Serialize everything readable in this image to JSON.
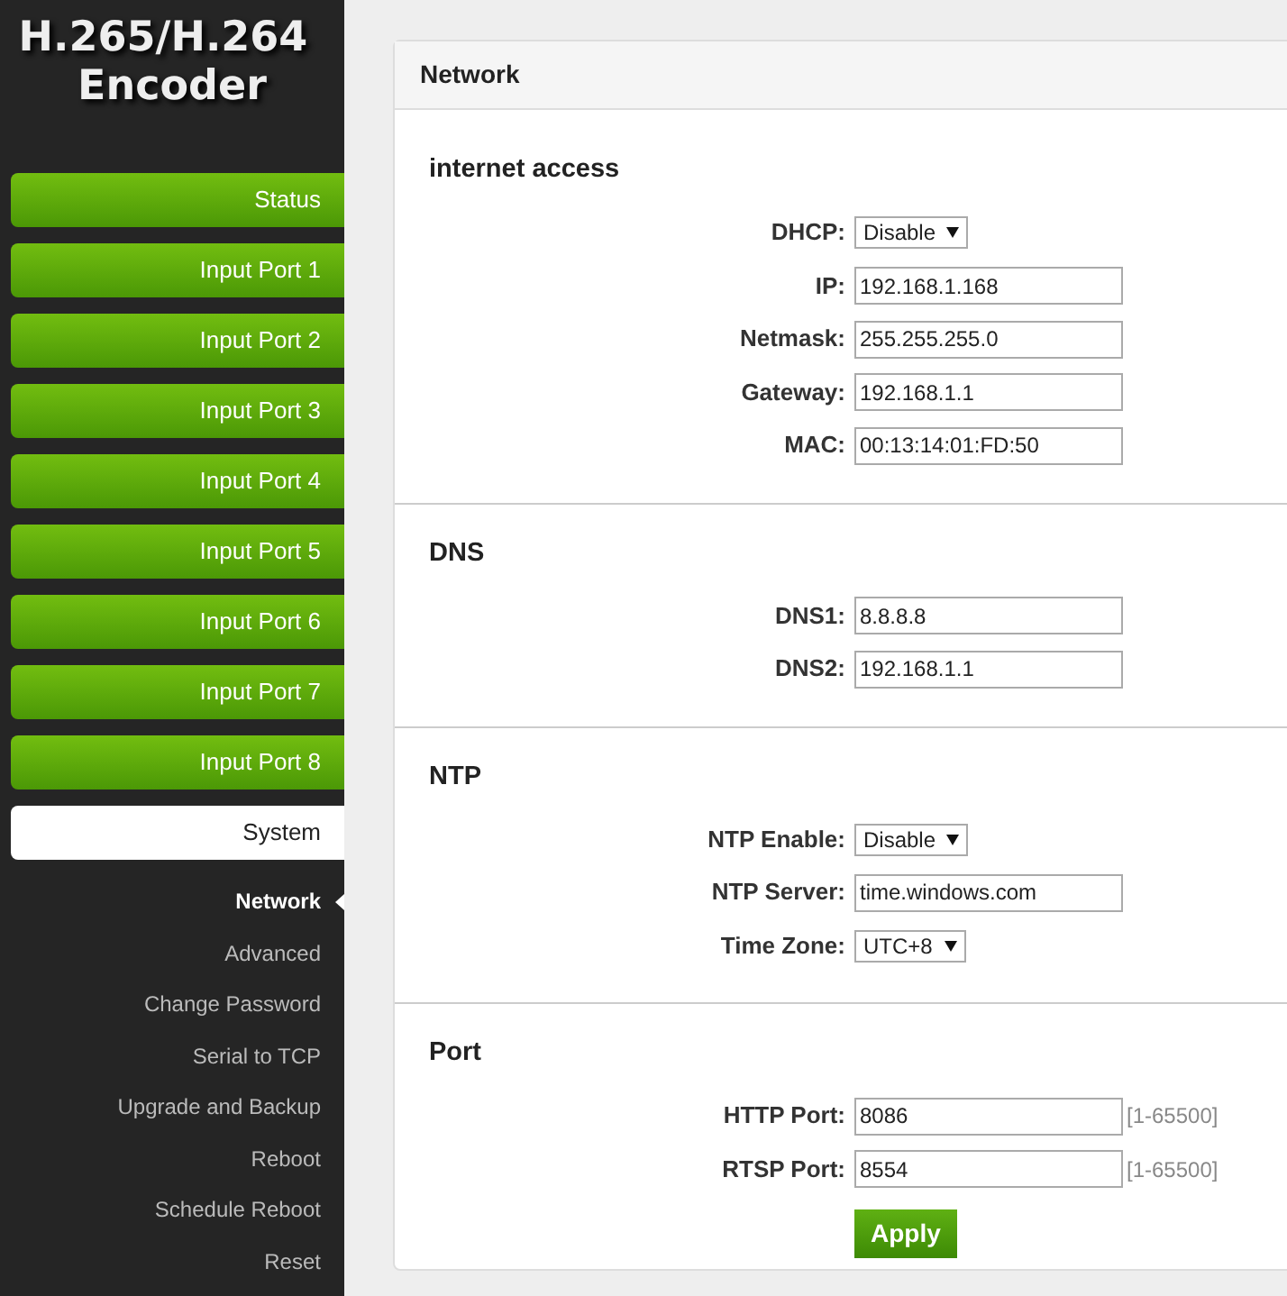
{
  "logo": {
    "line_1": "H.265/H.264",
    "line_2": "Encoder"
  },
  "menu": [
    {
      "label": "Status",
      "selected": false
    },
    {
      "label": "Input Port 1",
      "selected": false
    },
    {
      "label": "Input Port 2",
      "selected": false
    },
    {
      "label": "Input Port 3",
      "selected": false
    },
    {
      "label": "Input Port 4",
      "selected": false
    },
    {
      "label": "Input Port 5",
      "selected": false
    },
    {
      "label": "Input Port 6",
      "selected": false
    },
    {
      "label": "Input Port 7",
      "selected": false
    },
    {
      "label": "Input Port 8",
      "selected": false
    },
    {
      "label": "System",
      "selected": true,
      "children": [
        {
          "label": "Network",
          "selected": true
        },
        {
          "label": "Advanced",
          "selected": false
        },
        {
          "label": "Change Password",
          "selected": false
        },
        {
          "label": "Serial to TCP",
          "selected": false
        },
        {
          "label": "Upgrade and Backup",
          "selected": false
        },
        {
          "label": "Reboot",
          "selected": false
        },
        {
          "label": "Schedule Reboot",
          "selected": false
        },
        {
          "label": "Reset",
          "selected": false
        }
      ]
    }
  ],
  "panel": {
    "title": "Network",
    "sections": [
      {
        "title": "internet access",
        "fields": [
          {
            "kind": "select",
            "label": "DHCP:",
            "value": "Disable"
          },
          {
            "kind": "input",
            "label": "IP:",
            "value": "192.168.1.168"
          },
          {
            "kind": "input",
            "label": "Netmask:",
            "value": "255.255.255.0"
          },
          {
            "kind": "input",
            "label": "Gateway:",
            "value": "192.168.1.1"
          },
          {
            "kind": "input",
            "label": "MAC:",
            "value": "00:13:14:01:FD:50"
          }
        ]
      },
      {
        "title": "DNS",
        "fields": [
          {
            "kind": "input",
            "label": "DNS1:",
            "value": "8.8.8.8"
          },
          {
            "kind": "input",
            "label": "DNS2:",
            "value": "192.168.1.1"
          }
        ]
      },
      {
        "title": "NTP",
        "fields": [
          {
            "kind": "select",
            "label": "NTP Enable:",
            "value": "Disable"
          },
          {
            "kind": "input",
            "label": "NTP Server:",
            "value": "time.windows.com"
          },
          {
            "kind": "select",
            "label": "Time Zone:",
            "value": "UTC+8"
          }
        ]
      },
      {
        "title": "Port",
        "fields": [
          {
            "kind": "input",
            "label": "HTTP Port:",
            "value": "8086",
            "hint": "[1-65500]"
          },
          {
            "kind": "input",
            "label": "RTSP Port:",
            "value": "8554",
            "hint": "[1-65500]"
          }
        ]
      }
    ],
    "button": "Apply"
  }
}
